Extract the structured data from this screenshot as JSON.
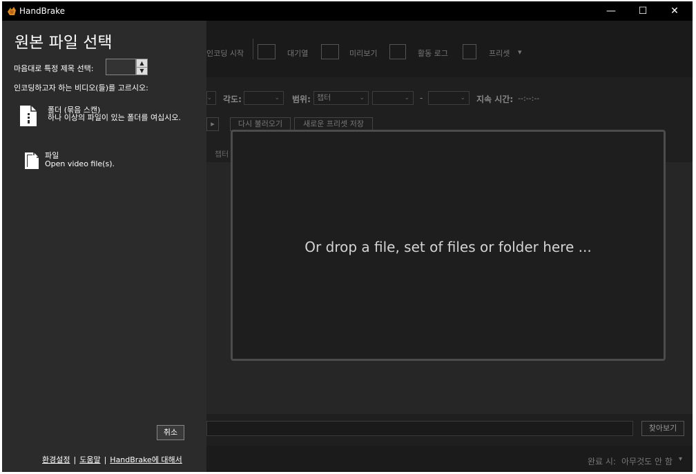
{
  "window": {
    "title": "HandBrake",
    "controls": {
      "minimize": "—",
      "maximize": "☐",
      "close": "✕"
    }
  },
  "toolbar": {
    "start_encode": "인코딩 시작",
    "queue": "대기열",
    "preview": "미리보기",
    "activity_log": "활동 로그",
    "presets": "프리셋",
    "presets_arrow": "▾"
  },
  "source_row": {
    "angle_label": "각도:",
    "range_label": "범위:",
    "range_value": "챕터",
    "range_dash": "-",
    "duration_label": "지속 시간:",
    "duration_value": "--:--:--"
  },
  "preset_row": {
    "reload": "다시 불러오기",
    "save_new": "새로운 프리셋 저장"
  },
  "tabs": {
    "chapters": "챕터"
  },
  "drop_zone": {
    "text": "Or drop a file, set of files or folder here ..."
  },
  "destination": {
    "browse": "찾아보기"
  },
  "status": {
    "when_done_label": "완료 시:",
    "when_done_value": "아무것도 안 함"
  },
  "flyout": {
    "title": "원본 파일 선택",
    "title_spec_label": "마음대로 특정 제목 선택:",
    "title_spec_value": "",
    "choose_label": "인코딩하고자 하는 비디오(들)를 고르시오:",
    "folder": {
      "title": "폴더 (묶음 스캔)",
      "desc": "하나 이상의 파일이 있는 폴더를 여십시오."
    },
    "file": {
      "title": "파일",
      "desc": "Open video file(s)."
    },
    "cancel": "취소",
    "footer": {
      "preferences": "환경설정",
      "help": "도움말",
      "about": "HandBrake에 대해서",
      "separator": "|"
    }
  },
  "colors": {
    "window_bg": "#1f1f1f",
    "flyout_bg": "#2b2b2b",
    "titlebar_bg": "#000000",
    "drop_border": "#4c4c4c"
  }
}
